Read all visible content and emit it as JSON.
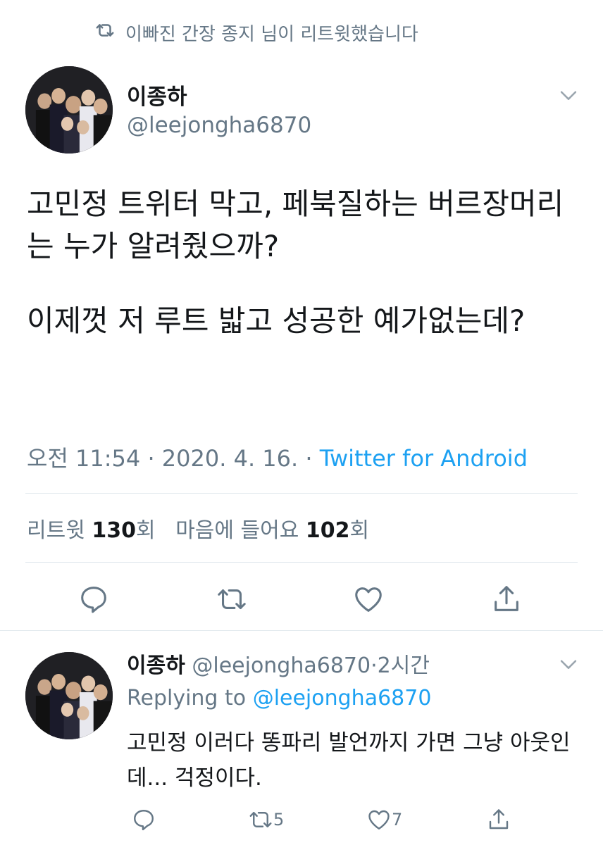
{
  "retweet_context": {
    "icon": "retweet-icon",
    "text": "이빠진 간장 종지 님이 리트윗했습니다"
  },
  "tweet": {
    "display_name": "이종하",
    "handle": "@leejongha6870",
    "paragraph1": "고민정 트위터 막고, 페북질하는 버르장머리는 누가 알려줬으까?",
    "paragraph2": "이제껏 저 루트 밟고 성공한 예가없는데?",
    "time": "오전 11:54",
    "separator": "·",
    "date": "2020. 4. 16.",
    "source": "Twitter for Android",
    "stats": {
      "retweets_label": "리트윗",
      "retweets_count": "130",
      "retweets_suffix": "회",
      "likes_label": "마음에 들어요",
      "likes_count": "102",
      "likes_suffix": "회"
    }
  },
  "reply": {
    "display_name": "이종하",
    "handle": "@leejongha6870",
    "separator": "·",
    "age": "2시간",
    "replying_prefix": "Replying to",
    "replying_handle": "@leejongha6870",
    "text": "고민정 이러다 똥파리 발언까지 가면 그냥 아웃인데... 걱정이다.",
    "retweet_count": "5",
    "like_count": "7"
  },
  "colors": {
    "text": "#14171a",
    "secondary": "#657786",
    "link": "#1da1f2",
    "divider": "#e1e8ed"
  }
}
